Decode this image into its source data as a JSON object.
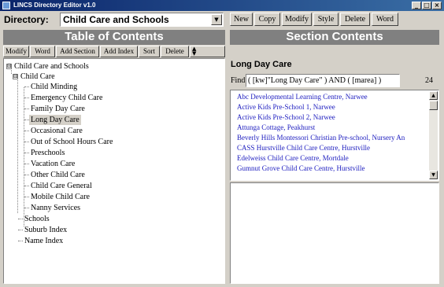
{
  "window": {
    "title": "LINCS Directory Editor v1.0",
    "controls": [
      "_",
      "□",
      "×"
    ]
  },
  "directory": {
    "label": "Directory:",
    "selected": "Child Care and Schools"
  },
  "toolbar": {
    "buttons": [
      "New",
      "Copy",
      "Modify",
      "Style",
      "Delete",
      "Word"
    ]
  },
  "toc": {
    "header": "Table of Contents",
    "buttons": [
      "Modify",
      "Word",
      "Add Section",
      "Add Index",
      "Sort",
      "Delete"
    ],
    "tree": [
      {
        "label": "Child Care and Schools",
        "level": 0,
        "expander": "⊟"
      },
      {
        "label": "Child Care",
        "level": 1,
        "expander": "⊟"
      },
      {
        "label": "Child Minding",
        "level": 2
      },
      {
        "label": "Emergency Child Care",
        "level": 2
      },
      {
        "label": "Family Day Care",
        "level": 2
      },
      {
        "label": "Long Day Care",
        "level": 2,
        "selected": true
      },
      {
        "label": "Occasional Care",
        "level": 2
      },
      {
        "label": "Out of School Hours Care",
        "level": 2
      },
      {
        "label": "Preschools",
        "level": 2
      },
      {
        "label": "Vacation Care",
        "level": 2
      },
      {
        "label": "Other Child Care",
        "level": 2
      },
      {
        "label": "Child Care General",
        "level": 2
      },
      {
        "label": "Mobile Child Care",
        "level": 2
      },
      {
        "label": "Nanny Services",
        "level": 2
      },
      {
        "label": "Schools",
        "level": 1
      },
      {
        "label": "Suburb Index",
        "level": 1
      },
      {
        "label": "Name Index",
        "level": 1
      }
    ]
  },
  "section": {
    "header": "Section Contents",
    "title": "Long Day Care",
    "find_label": "Find:",
    "find_value": "( [kw]\"Long Day Care\" ) AND ( [marea] )",
    "count": "24",
    "results": [
      "Abc Developmental Learning Centre,  Narwee",
      "Active Kids Pre-School 1,  Narwee",
      "Active Kids Pre-School 2,  Narwee",
      "Attunga Cottage,  Peakhurst",
      "Beverly Hills Montessori Christian Pre-school, Nursery An",
      "CASS Hurstville Child Care Centre,  Hurstville",
      "Edelweiss Child Care Centre,  Mortdale",
      "Gumnut Grove Child Care Centre,  Hurstville"
    ],
    "result_color": "#2020c0"
  }
}
